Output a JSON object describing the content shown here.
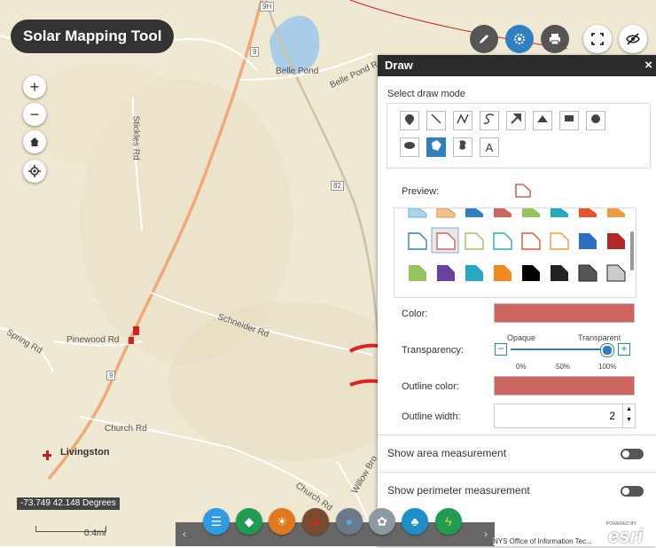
{
  "app": {
    "title": "Solar Mapping Tool"
  },
  "map": {
    "zoom_in": "+",
    "zoom_out": "−",
    "labels": {
      "belle_pond": "Belle Pond",
      "belle_pond_rd": "Belle Pond Rd",
      "stickles_rd": "Stickles Rd",
      "schneider_rd": "Schneider Rd",
      "pinewood_rd": "Pinewood Rd",
      "spring_rd": "Spring Rd",
      "church_rd": "Church Rd",
      "church_rd2": "Church Rd",
      "willow_brook": "Willow Bro",
      "livingston": "Livingston",
      "route_9": "9",
      "route_9h": "9H",
      "route_82": "82",
      "route_9b": "9"
    },
    "coordinates": "-73.749 42.148 Degrees",
    "scale": "0.4mi",
    "attribution": "NYS Office of Information Tec...",
    "esri_logo": "esri",
    "powered_by": "POWERED BY"
  },
  "toolbar": {
    "icons": [
      "pencil-icon",
      "gear-icon",
      "print-icon",
      "fullscreen-icon",
      "hide-icon"
    ]
  },
  "panel": {
    "title": "Draw",
    "close": "×",
    "select_mode_label": "Select draw mode",
    "preview_label": "Preview:",
    "color_label": "Color:",
    "transparency_label": "Transparency:",
    "opaque": "Opaque",
    "transparent": "Transparent",
    "ticks": [
      "0%",
      "50%",
      "100%"
    ],
    "transparency_value": 0.96,
    "outline_color_label": "Outline color:",
    "outline_width_label": "Outline width:",
    "outline_width_value": "2",
    "show_area": "Show area measurement",
    "show_perimeter": "Show perimeter measurement",
    "fill_color": "#cd6660",
    "outline_color": "#cd6660",
    "draw_modes": [
      "point",
      "line",
      "polyline",
      "freehand-polyline",
      "arrow",
      "triangle",
      "rectangle",
      "circle",
      "ellipse",
      "polygon",
      "freehand-polygon",
      "text"
    ],
    "text_mode_label": "A"
  },
  "dock": {
    "items": [
      "legend",
      "layers",
      "solar",
      "apple",
      "water",
      "agriculture",
      "land",
      "energy"
    ]
  }
}
